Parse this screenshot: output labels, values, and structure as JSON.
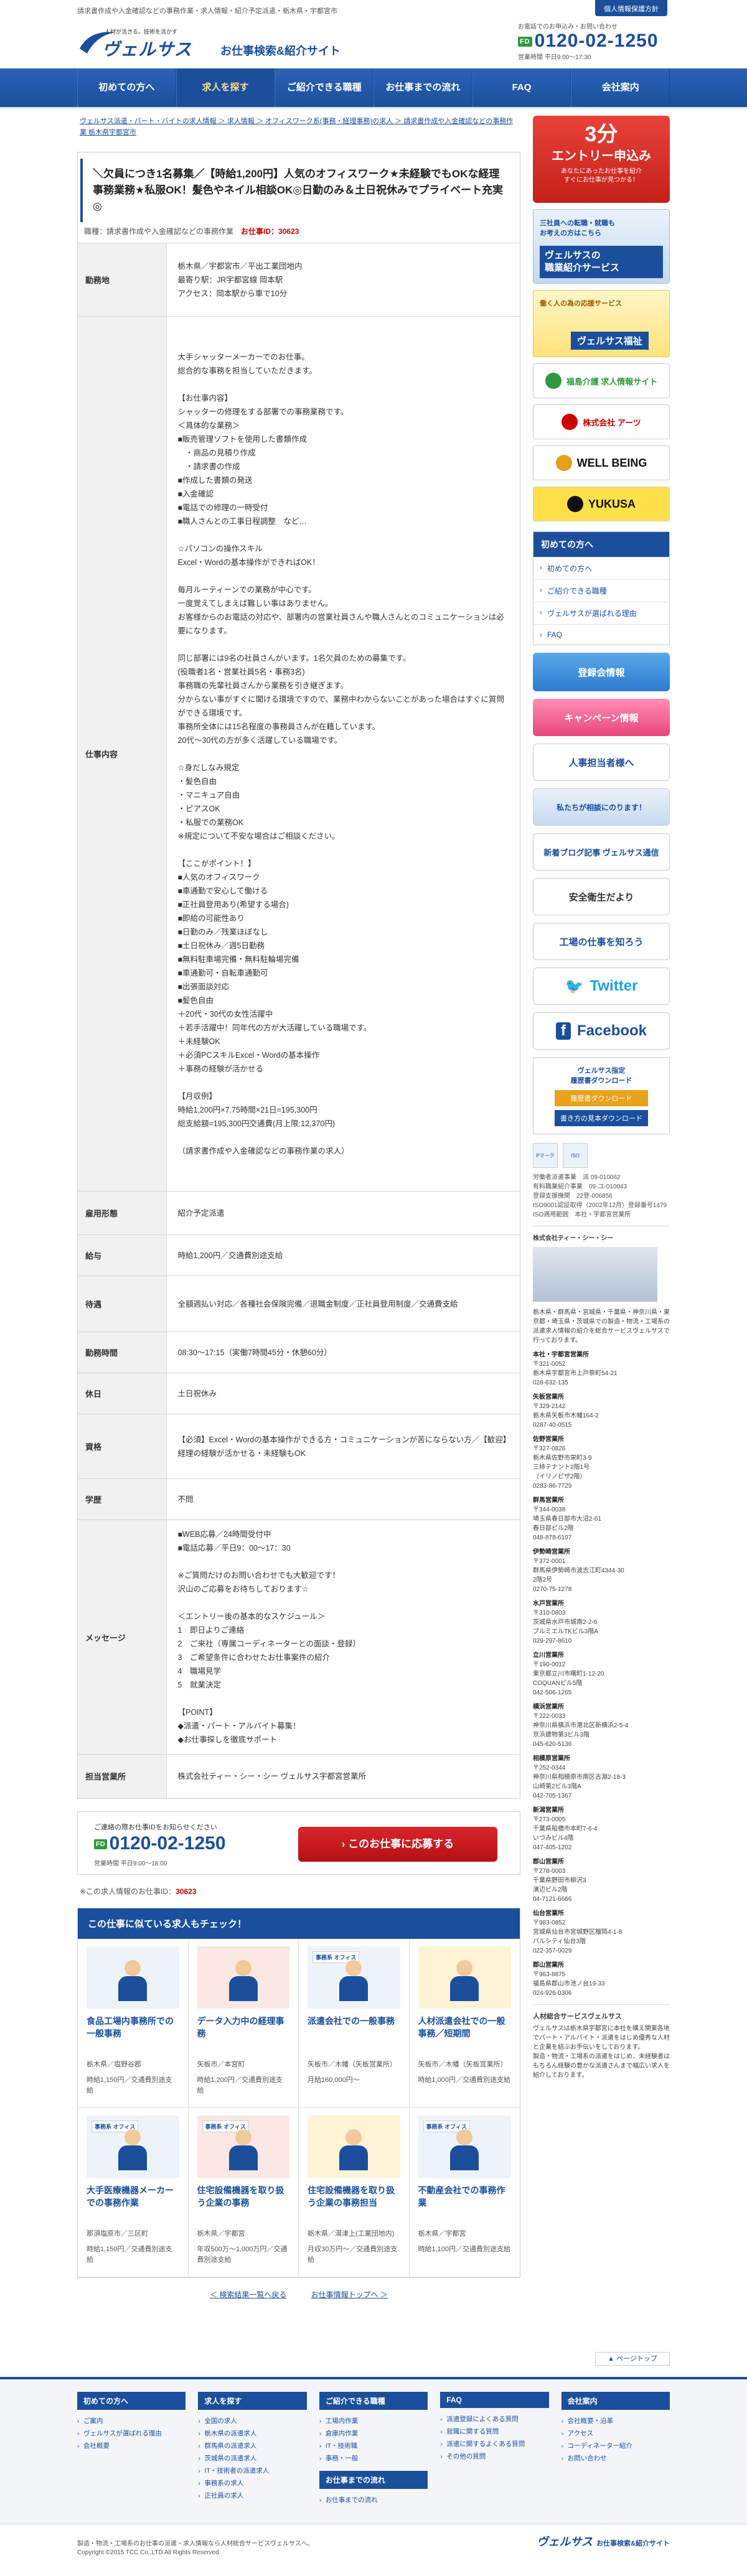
{
  "top": {
    "tagline": "請求書作成や入金確認などの事務作業・求人情報・紹介予定派遣・栃木県・宇都宮市",
    "privacy": "個人情報保護方針"
  },
  "brand": {
    "tiny": "人材が活きる。技術を活かす",
    "name": "ヴェルサス",
    "sub": "お仕事検索&紹介サイト",
    "accent": "#1b4f9c"
  },
  "phone": {
    "label": "お電話でのお申込み・お問い合わせ",
    "free_badge": "FD",
    "number": "0120-02-1250",
    "hours": "営業時間 平日9:00〜17:30"
  },
  "nav": [
    "初めての方へ",
    "求人を探す",
    "ご紹介できる職種",
    "お仕事までの流れ",
    "FAQ",
    "会社案内"
  ],
  "breadcrumb": "ヴェルサス派遣・パート・バイトの求人情報 ＞ 求人情報 ＞ オフィスワーク系(事務・経理事務)の求人 ＞ 請求書作成や入金確認などの事務作業 栃木県宇都宮市",
  "job": {
    "title": "＼欠員につき1名募集／【時給1,200円】人気のオフィスワーク★未経験でもOKな経理事務業務★私服OK！髪色やネイル相談OK◎日勤のみ＆土日祝休みでプライベート充実◎",
    "type_label": "職種：請求書作成や入金確認などの事務作業",
    "id_label": "お仕事ID：",
    "id_value": "30623"
  },
  "details": [
    {
      "label": "勤務地",
      "value": "栃木県／宇都宮市／平出工業団地内\n最寄り駅：JR宇都宮線 岡本駅\nアクセス：岡本駅から車で10分"
    },
    {
      "label": "仕事内容",
      "value": "大手シャッターメーカーでのお仕事。\n総合的な事務を担当していただきます。\n\n【お仕事内容】\nシャッターの修理をする部署での事務業務です。\n＜具体的な業務＞\n■販売管理ソフトを使用した書類作成\n　・商品の見積り作成\n　・請求書の作成\n■作成した書類の発送\n■入金確認\n■電話での修理の一時受付\n■職人さんとの工事日程調整　など…\n\n☆パソコンの操作スキル\nExcel・Wordの基本操作ができればOK！\n\n毎月ルーティーンでの業務が中心です。\n一度覚えてしまえば難しい事はありません。\nお客様からのお電話の対応や、部署内の営業社員さんや職人さんとのコミュニケーションは必要になります。\n\n同じ部署には9名の社員さんがいます。1名欠員のための募集です。\n(役職者1名・営業社員5名・事務3名)\n事務職の先輩社員さんから業務を引き継ぎます。\n分からない事がすぐに聞ける環境ですので、業務中わからないことがあった場合はすぐに質問ができる環境です。\n事務所全体には15名程度の事務員さんが在籍しています。\n20代〜30代の方が多く活躍している職場です。\n\n☆身だしなみ規定\n・髪色自由\n・マニキュア自由\n・ピアスOK\n・私服での業務OK\n※規定について不安な場合はご相談ください。\n\n【ここがポイント！】\n■人気のオフィスワーク\n■車通勤で安心して働ける\n■正社員登用あり(希望する場合)\n■即給の可能性あり\n■日勤のみ／残業ほぼなし\n■土日祝休み／週5日勤務\n■無料駐車場完備・無料駐輪場完備\n■車通勤可・自転車通勤可\n■出張面談対応\n■髪色自由\n＋20代・30代の女性活躍中\n＋若手活躍中！同年代の方が大活躍している職場です。\n＋未経験OK\n＋必須PCスキルExcel・Wordの基本操作\n＋事務の経験が活かせる\n\n【月収例】\n時給1,200円×7.75時間×21日=195,300円\n総支給額=195,300円交通費(月上限:12,370円)\n\n（請求書作成や入金確認などの事務作業の求人）"
    },
    {
      "label": "雇用形態",
      "value": "紹介予定派遣"
    },
    {
      "label": "給与",
      "value": "時給1,200円／交通費別途支給"
    },
    {
      "label": "待遇",
      "value": "全額週払い対応／各種社会保険完備／退職金制度／正社員登用制度／交通費支給"
    },
    {
      "label": "勤務時間",
      "value": "08:30〜17:15（実働7時間45分・休憩60分）"
    },
    {
      "label": "休日",
      "value": "土日祝休み"
    },
    {
      "label": "資格",
      "value": "【必須】Excel・Wordの基本操作ができる方・コミュニケーションが苦にならない方／【歓迎】経理の経験が活かせる・未経験もOK"
    },
    {
      "label": "学歴",
      "value": "不問"
    },
    {
      "label": "メッセージ",
      "value": "■WEB応募／24時間受付中\n■電話応募／平日9：00〜17：30\n\n※ご質問だけのお問い合わせでも大歓迎です！\n沢山のご応募をお待ちしております☆\n\n＜エントリー後の基本的なスケジュール＞\n1　即日よりご連絡\n2　ご来社（専属コーディネーターとの面談・登録）\n3　ご希望条件に合わせたお仕事案件の紹介\n4　職場見学\n5　就業決定\n\n【POINT】\n◆派遣・パート・アルバイト募集！\n◆お仕事探しを徹底サポート"
    },
    {
      "label": "担当営業所",
      "value": "株式会社ティー・シー・シー ヴェルサス宇都宮営業所"
    }
  ],
  "apply": {
    "msg": "ご連絡の際お仕事IDをお知らせください",
    "free_badge": "FD",
    "number": "0120-02-1250",
    "hours": "営業時間 平日9:00〜18:00",
    "button": "›  このお仕事に応募する"
  },
  "id_footer": {
    "prefix": "※この求人情報のお仕事ID：",
    "value": "30623"
  },
  "similar": {
    "heading": "この仕事に似ている求人もチェック！",
    "items": [
      {
        "tag": "",
        "title": "食品工場内事務所での一般事務",
        "loc": "栃木県／塩野谷郡",
        "wage": "時給1,150円／交通費別途支給"
      },
      {
        "tag": "",
        "title": "データ入力中の経理事務",
        "loc": "矢板市／本宮町",
        "wage": "時給1,200円／交通費別途支給"
      },
      {
        "tag": "事務系 オフィス",
        "title": "派遣会社での一般事務",
        "loc": "矢板市／木幡（矢板営業所）",
        "wage": "月給160,000円〜"
      },
      {
        "tag": "",
        "title": "人材派遣会社での一般事務／短期間",
        "loc": "矢板市／木幡（矢板営業所）",
        "wage": "時給1,000円／交通費別途支給"
      },
      {
        "tag": "事務系 オフィス",
        "title": "大手医療機器メーカーでの事務作業",
        "loc": "那須塩原市／三区町",
        "wage": "時給1,150円／交通費別途支給"
      },
      {
        "tag": "事務系 オフィス",
        "title": "住宅設備機器を取り扱う企業の事務",
        "loc": "栃木県／宇都宮",
        "wage": "年収500万〜1,000万円／交通費別途支給"
      },
      {
        "tag": "",
        "title": "住宅設備機器を取り扱う企業の事務担当",
        "loc": "栃木県／湯津上(工業団地内)",
        "wage": "月収30万円〜／交通費別途支給"
      },
      {
        "tag": "事務系 オフィス",
        "title": "不動産会社での事務作業",
        "loc": "栃木県／宇都宮",
        "wage": "時給1,100円／交通費別途支給"
      }
    ],
    "links": [
      "＜ 検索結果一覧へ戻る",
      "お仕事情報トップへ ＞"
    ]
  },
  "sidebar": {
    "entry_big": "3分",
    "entry_mid": "エントリー申込み",
    "entry_small": "あなたにあったお仕事を紹介\nすぐにお仕事が見つかる！",
    "blue_banner_sub": "三社員への転職・就職も\nお考えの方はこちら",
    "blue_banner_main": "ヴェルサスの\n職業紹介サービス",
    "yellow_banner_sub": "働く人の為の応援サービス",
    "yellow_banner_main": "ヴェルサス福祉",
    "logo_banners": [
      "福島介護 求人情報サイト",
      "株式会社 アーツ",
      "WELL BEING",
      "YUKUSA"
    ],
    "menu_heading": "初めての方へ",
    "menu_items": [
      "初めての方へ",
      "ご紹介できる職種",
      "ヴェルサスが選ばれる理由",
      "FAQ"
    ],
    "buttons": [
      "登録会情報",
      "キャンペーン情報",
      "人事担当者様へ",
      "私たちが相談にのります！",
      "新着ブログ記事 ヴェルサス通信",
      "安全衛生だより",
      "工場の仕事を知ろう"
    ],
    "twitter": "Twitter",
    "facebook": "Facebook",
    "dl_title": "ヴェルサス指定\n履歴書ダウンロード",
    "dl_buttons": [
      "履歴書ダウンロード",
      "書き方の見本ダウンロード"
    ],
    "cert_marks": [
      "Pマーク",
      "ISO"
    ],
    "cert_text": "労働者派遣事業　派 09-010062\n有料職業紹介事業　09-ユ-010043\n登録支援機関　22登-006856\nISO9001認証取得（2002年12月）登録番号1479\nISO適用範囲　本社・宇都宮営業所",
    "company_name": "株式会社ティー・シー・シー",
    "company_desc": "栃木県・群馬県・宮城県・千葉県・神奈川県・東京都・埼玉県・茨城県での製造・物流・工場系の派遣求人情報の紹介を総合サービスヴェルサスで行っております。",
    "offices": [
      {
        "name": "本社・宇都宮営業所",
        "addr": "〒321-0052\n栃木県宇都宮市上戸祭町54-21\n028-632-135"
      },
      {
        "name": "矢板営業所",
        "addr": "〒329-2142\n栃木県矢板市木幡164-2\n0287-40-0515"
      },
      {
        "name": "佐野営業所",
        "addr": "〒327-0826\n栃木県佐野市栄町3-9\n三柿テナント2階1号\n（イリノピザ2階）\n0283-86-7729"
      },
      {
        "name": "群馬営業所",
        "addr": "〒344-0038\n埼玉県春日部市大沼2-61\n春日部ビル2階\n048-878-6107"
      },
      {
        "name": "伊勢崎営業所",
        "addr": "〒372-0001\n群馬県伊勢崎市波志江町4344-30\n2階2号\n0270-75-1278"
      },
      {
        "name": "水戸営業所",
        "addr": "〒310-0803\n茨城県水戸市城南2-2-6\nプルミエルTKビル3階A\n029-297-8610"
      },
      {
        "name": "立川営業所",
        "addr": "〒190-0012\n東京都立川市曙町1-12-20\nCOQUANビル5階\n042-506-1265"
      },
      {
        "name": "横浜営業所",
        "addr": "〒222-0033\n神奈川県横浜市港北区新横浜2-5-4\n京浜建物第3ビル3階\n045-620-5136"
      },
      {
        "name": "相模原営業所",
        "addr": "〒252-0344\n神奈川県相模原市南区古淵2-18-3\n山崎第2ビル3階A\n042-705-1367"
      },
      {
        "name": "新潟営業所",
        "addr": "〒273-0005\n千葉県船橋市本町7-6-4\nいづみビル4階\n047-405-1202"
      },
      {
        "name": "郡山営業所",
        "addr": "〒278-0003\n千葉県野田市柳沢3\n濱辺ビル2階\n04-7121-6666"
      },
      {
        "name": "仙台営業所",
        "addr": "〒983-0852\n宮城県仙台市宮城野区榴岡4-1-8\nパルシティ仙台3階\n022-357-0029"
      },
      {
        "name": "郡山営業所",
        "addr": "〒963-8875\n福島県郡山市池ノ台19-33\n024-926-0306"
      }
    ],
    "about_heading": "人材総合サービスヴェルサス",
    "about_text": "ヴェルサスは栃木県宇都宮に本社を構え関東各地でパート・アルバイト・派遣をはじめ優秀な人材と企業を結ぶお手伝いをしております。\n製造・物流・工場系の派遣をはじめ、未経験者はもちろん経験の豊かな派遣さんまで幅広い求人を紹介しております。"
  },
  "pagetop": "▲ ページトップ",
  "footer": {
    "cols": [
      {
        "heading": "初めての方へ",
        "items": [
          "ご案内",
          "ヴェルサスが選ばれる理由",
          "会社概要"
        ]
      },
      {
        "heading": "求人を探す",
        "items": [
          "全国の求人",
          "栃木県の派遣求人",
          "群馬県の派遣求人",
          "茨城県の派遣求人",
          "IT・技術者の派遣求人",
          "事務系の求人",
          "正社員の求人"
        ]
      },
      {
        "heading": "ご紹介できる職種",
        "items": [
          "工場内作業",
          "倉庫内作業",
          "IT・技術職",
          "事務・一般"
        ]
      },
      {
        "heading": "FAQ",
        "items": [
          "派遣登録によくある質問",
          "就職に関する質問",
          "派遣に関するよくある質問",
          "その他の質問"
        ]
      },
      {
        "heading": "会社案内",
        "items": [
          "会社概要・沿革",
          "アクセス",
          "コーディネーター紹介",
          "お問い合わせ"
        ]
      }
    ],
    "extra_heading": "お仕事までの流れ",
    "extra_items": [
      "お仕事までの流れ"
    ],
    "desc": "製造・物流・工場系のお仕事の派遣・求人情報なら人材総合サービスヴェルサスへ。",
    "copy": "Copyright ©2015 TCC Co.,LTD All Rights Reserved.",
    "logo": "ヴェルサス",
    "logo_sub": "お仕事検索&紹介サイト"
  }
}
